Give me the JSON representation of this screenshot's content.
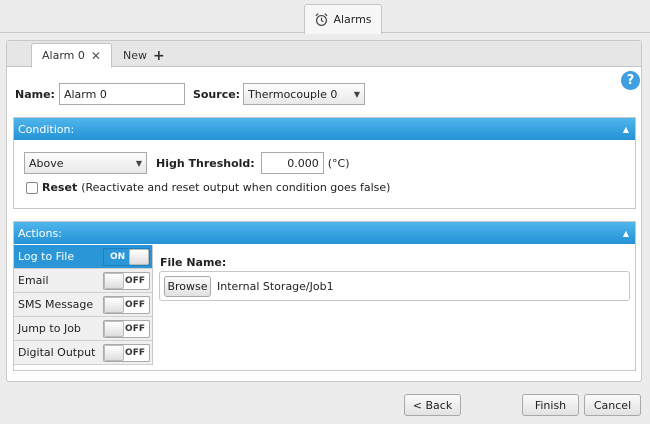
{
  "top_tab": {
    "label": "Alarms",
    "icon": "alarm-clock-icon"
  },
  "subtabs": {
    "active_label": "Alarm 0",
    "new_label": "New"
  },
  "help_label": "?",
  "form": {
    "name_label": "Name:",
    "name_value": "Alarm 0",
    "source_label": "Source:",
    "source_value": "Thermocouple 0"
  },
  "condition": {
    "title": "Condition:",
    "operator_value": "Above",
    "threshold_label": "High Threshold:",
    "threshold_value": "0.000",
    "threshold_unit": "(°C)",
    "reset_label": "Reset",
    "reset_desc": "(Reactivate and reset output when condition goes false)"
  },
  "actions": {
    "title": "Actions:",
    "items": [
      {
        "label": "Log to File",
        "toggle": "ON"
      },
      {
        "label": "Email",
        "toggle": "OFF"
      },
      {
        "label": "SMS Message",
        "toggle": "OFF"
      },
      {
        "label": "Jump to Job",
        "toggle": "OFF"
      },
      {
        "label": "Digital Output",
        "toggle": "OFF"
      }
    ],
    "file_name_label": "File Name:",
    "browse_label": "Browse",
    "file_path": "Internal Storage/Job1"
  },
  "footer": {
    "back_label": "< Back",
    "finish_label": "Finish",
    "cancel_label": "Cancel"
  },
  "colors": {
    "accent": "#2a96d8",
    "help": "#3f9fe0"
  }
}
